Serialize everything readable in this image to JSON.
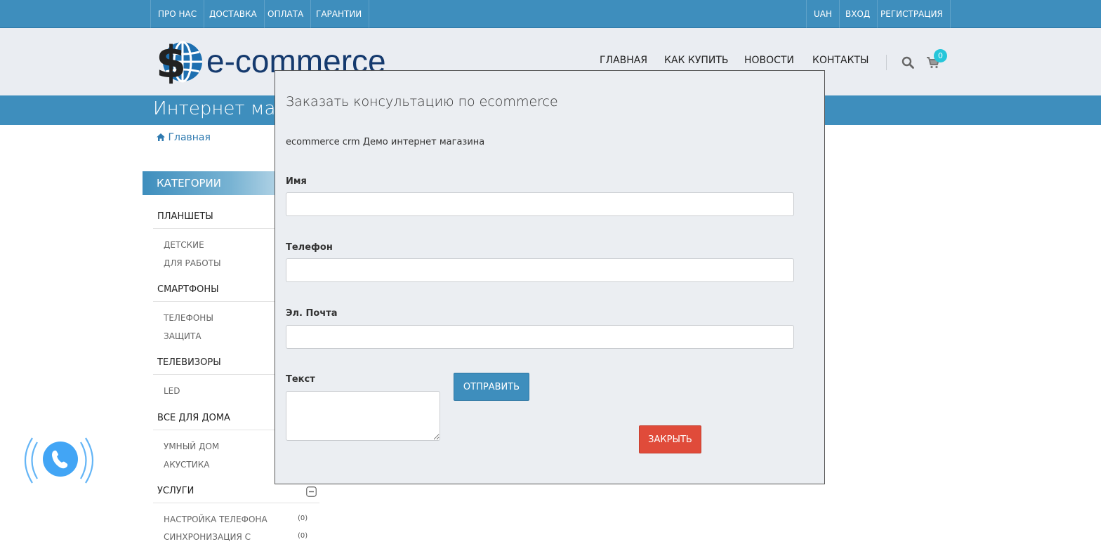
{
  "topbar": {
    "left_links": [
      "ПРО НАС",
      "ДОСТАВКА",
      "ОПЛАТА",
      "ГАРАНТИИ"
    ],
    "right_links": [
      "UAH",
      "ВХОД",
      "РЕГИСТРАЦИЯ"
    ]
  },
  "header": {
    "logo_text": "e-commerce",
    "nav": [
      "ГЛАВНАЯ",
      "КАК КУПИТЬ",
      "НОВОСТИ",
      "КОНТАКТЫ"
    ],
    "search_icon": "search-icon",
    "cart_icon": "cart-icon",
    "cart_count": "0"
  },
  "title_strip": {
    "text": "Интернет мага"
  },
  "breadcrumb": {
    "label": "Главная",
    "icon": "home-icon"
  },
  "sidebar": {
    "header": "КАТЕГОРИИ",
    "categories": [
      {
        "label": "ПЛАНШЕТЫ",
        "subs": [
          "ДЕТСКИЕ",
          "ДЛЯ РАБОТЫ"
        ]
      },
      {
        "label": "СМАРТФОНЫ",
        "subs": [
          "ТЕЛЕФОНЫ",
          "ЗАЩИТА"
        ]
      },
      {
        "label": "ТЕЛЕВИЗОРЫ",
        "subs": [
          "LED"
        ]
      },
      {
        "label": "ВСЕ ДЛЯ ДОМА",
        "subs": [
          "УМНЫЙ ДОМ",
          "АКУСТИКА"
        ]
      },
      {
        "label": "УСЛУГИ",
        "subs": [
          "НАСТРОЙКА ТЕЛЕФОНА",
          "СИНХРОНИЗАЦИЯ С"
        ],
        "counts": [
          "(0)",
          "(0)"
        ]
      }
    ]
  },
  "call_widget": {
    "icon": "phone-icon"
  },
  "modal": {
    "title": "Заказать консультацию по ecommerce",
    "subtitle": "ecommerce crm Демо интернет магазина",
    "name_label": "Имя",
    "name_value": "",
    "phone_label": "Телефон",
    "phone_value": "",
    "email_label": "Эл. Почта",
    "email_value": "",
    "text_label": "Текст",
    "text_value": "",
    "send_label": "ОТПРАВИТЬ",
    "close_label": "ЗАКРЫТЬ"
  },
  "colors": {
    "primary": "#3e8ebd",
    "header_bg": "#eaedf2",
    "logo_blue": "#153a6e",
    "danger": "#e04b3a",
    "badge": "#26c6da",
    "call_widget": "#42a5f5"
  }
}
